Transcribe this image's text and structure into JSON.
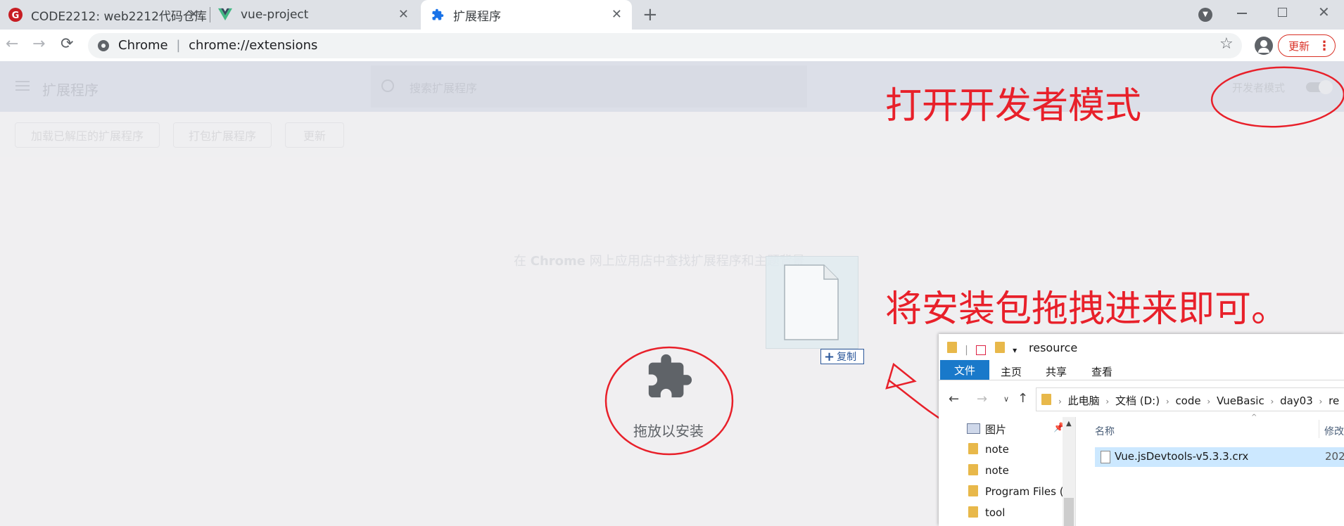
{
  "tabs": [
    {
      "title": "CODE2212: web2212代码仓库",
      "icon": "gitee-icon",
      "active": false
    },
    {
      "title": "vue-project",
      "icon": "vue-icon",
      "active": false
    },
    {
      "title": "扩展程序",
      "icon": "puzzle-icon",
      "active": true
    }
  ],
  "toolbar": {
    "address_prefix": "Chrome",
    "address_sep": "|",
    "address_url": "chrome://extensions",
    "update_label": "更新"
  },
  "extensions": {
    "title": "扩展程序",
    "search_placeholder": "搜索扩展程序",
    "dev_mode_label": "开发者模式",
    "buttons": [
      "加载已解压的扩展程序",
      "打包扩展程序",
      "更新"
    ],
    "store_text_pre": "在",
    "store_text_brand": "Chrome",
    "store_text_post": "网上应用店中查找扩展程序和主题背景",
    "drop_label": "拖放以安装",
    "copy_badge": "复制"
  },
  "annotations": {
    "dev_mode_note": "打开开发者模式",
    "drag_note": "将安装包拖拽进来即可。"
  },
  "explorer": {
    "title": "resource",
    "ribbon_tabs": [
      "文件",
      "主页",
      "共享",
      "查看"
    ],
    "breadcrumb": [
      "此电脑",
      "文档 (D:)",
      "code",
      "VueBasic",
      "day03",
      "re"
    ],
    "nav_items": [
      "图片",
      "note",
      "note",
      "Program Files (",
      "tool"
    ],
    "column_name": "名称",
    "column_modified": "修改",
    "file_name": "Vue.jsDevtools-v5.3.3.crx",
    "file_date": "202"
  }
}
